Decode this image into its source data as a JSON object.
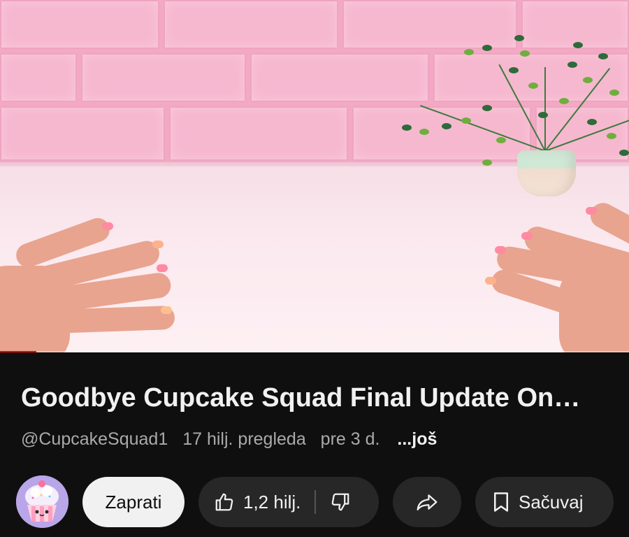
{
  "video": {
    "progress_fraction": 0.058
  },
  "title": "Goodbye Cupcake Squad Final Update On…",
  "meta": {
    "channel": "@CupcakeSquad1",
    "views": "17 hilj. pregleda",
    "age": "pre 3 d.",
    "more": "...još"
  },
  "actions": {
    "subscribe_label": "Zaprati",
    "likes": "1,2 hilj.",
    "save_label": "Sačuvaj"
  },
  "icons": {
    "like": "thumbs-up-icon",
    "dislike": "thumbs-down-icon",
    "share": "share-arrow-icon",
    "save": "bookmark-icon"
  },
  "colors": {
    "background": "#0f0f0f",
    "pill": "#272727",
    "subscribe_bg": "#f1f1f1",
    "progress": "#ff0000"
  }
}
